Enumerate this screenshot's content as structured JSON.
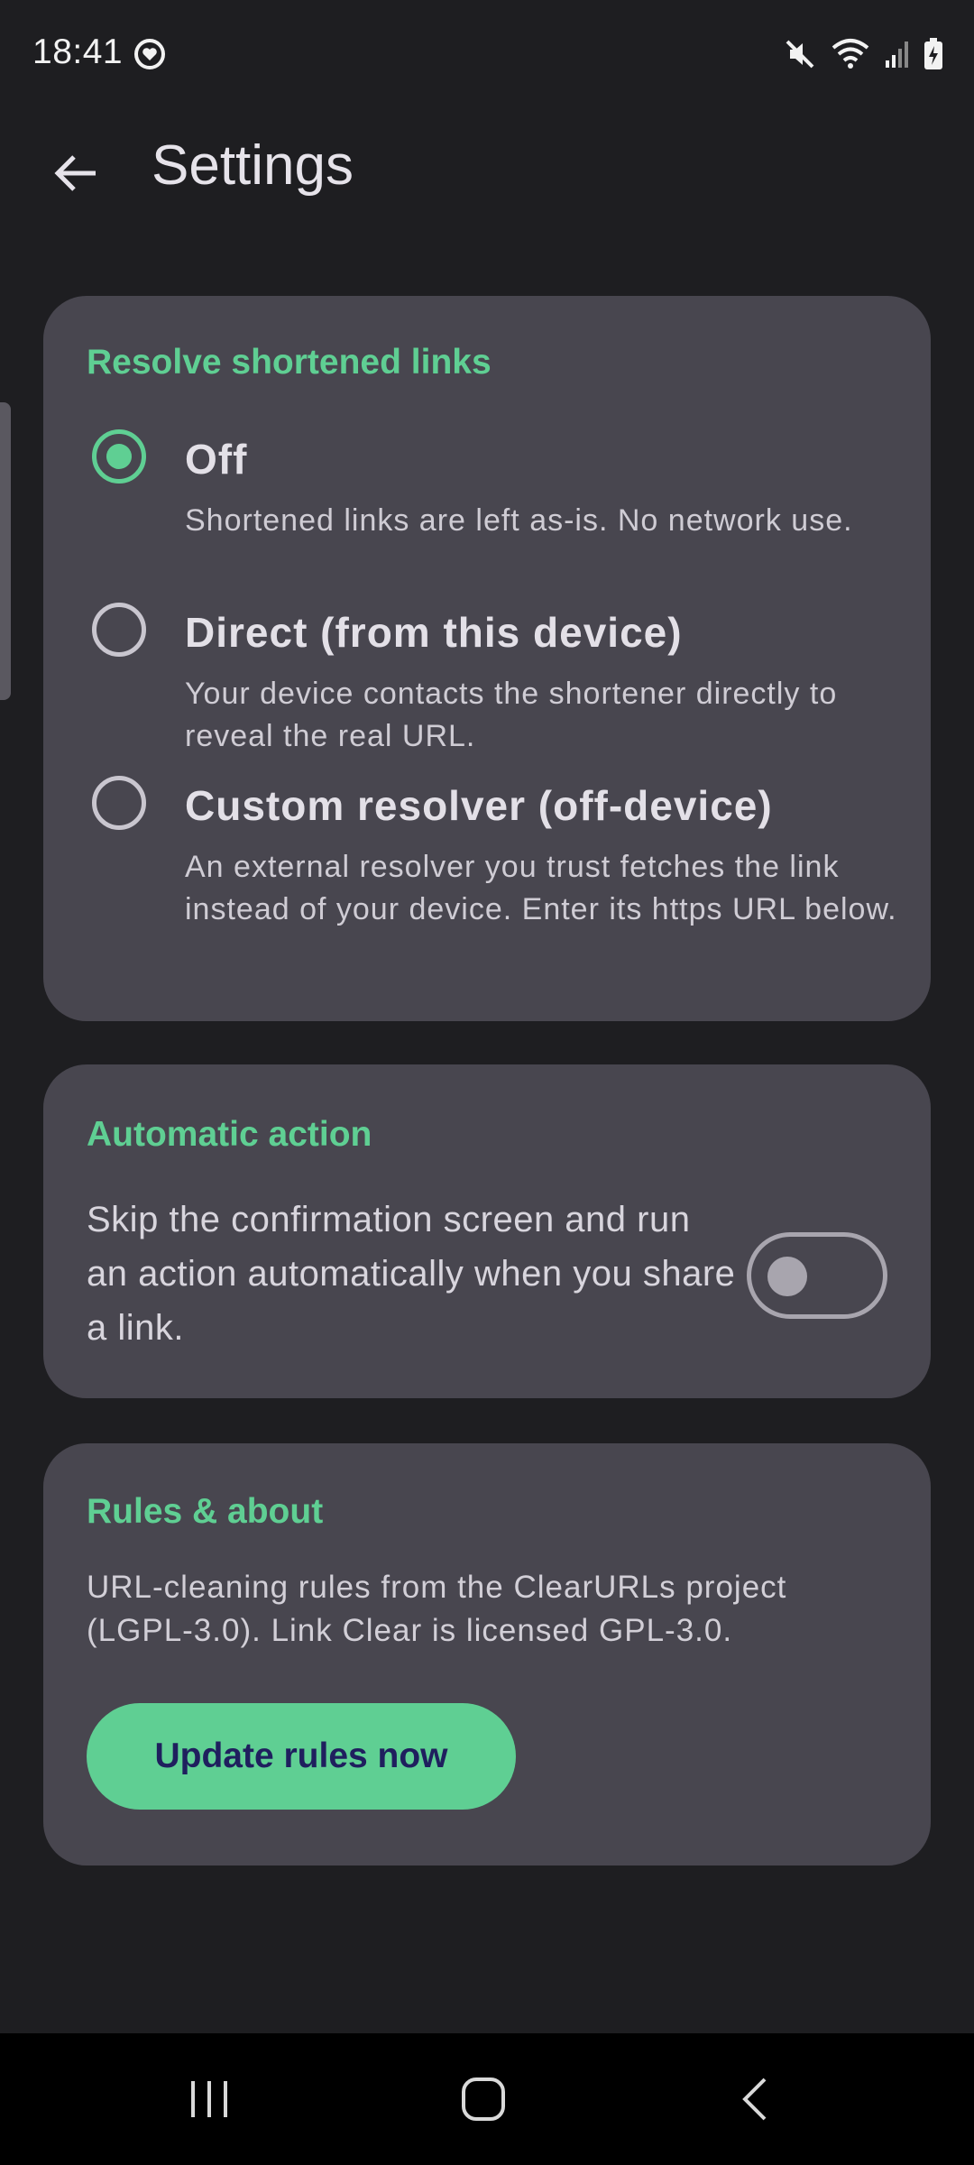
{
  "status_bar": {
    "time": "18:41",
    "left_icon": "heart-sync-icon",
    "right_icons": [
      "mute-icon",
      "wifi-icon",
      "signal-icon",
      "battery-icon"
    ]
  },
  "app_bar": {
    "back_icon": "arrow-back-icon",
    "title": "Settings"
  },
  "resolve_card": {
    "heading": "Resolve shortened links",
    "options": [
      {
        "title": "Off",
        "description": "Shortened links are left as-is. No network use.",
        "selected": true
      },
      {
        "title": "Direct (from this device)",
        "description": "Your device contacts the shortener directly to reveal the real URL.",
        "selected": false
      },
      {
        "title": "Custom resolver (off-device)",
        "description": "An external resolver you trust fetches the link instead of your device. Enter its https URL below.",
        "selected": false
      }
    ]
  },
  "auto_card": {
    "heading": "Automatic action",
    "description": "Skip the confirmation screen and run an action automatically when you share a link.",
    "toggle_on": false
  },
  "rules_card": {
    "heading": "Rules & about",
    "description": "URL-cleaning rules from the ClearURLs project (LGPL-3.0). Link Clear is licensed GPL-3.0.",
    "button_label": "Update rules now"
  },
  "nav_bar": {
    "icons": [
      "recent-apps-icon",
      "home-icon",
      "back-icon"
    ]
  },
  "colors": {
    "accent": "#5fcf93",
    "background": "#1e1e21",
    "card": "#48464f",
    "button_text": "#1f1f5e"
  }
}
